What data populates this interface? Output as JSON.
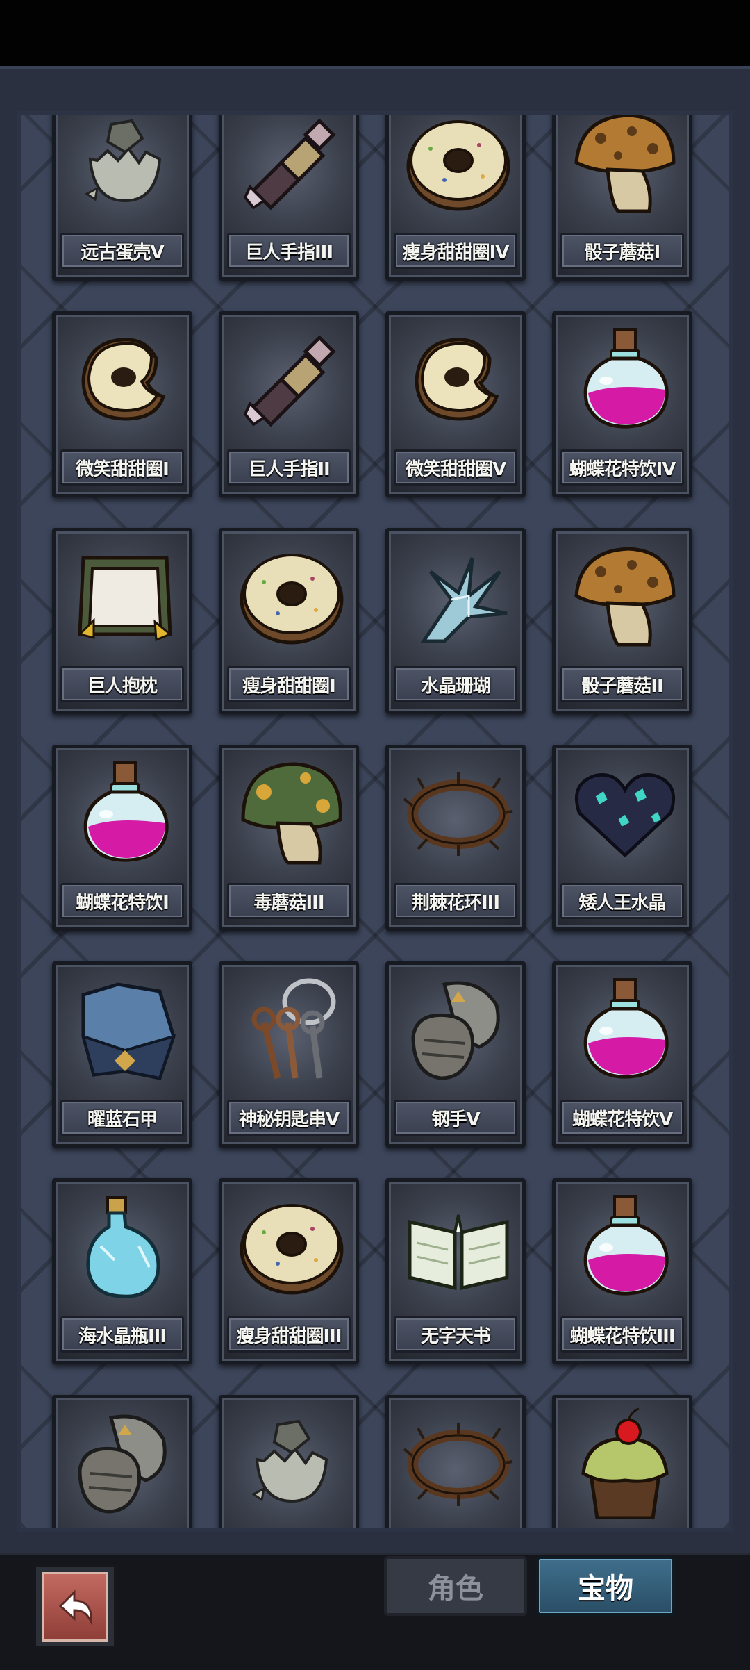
{
  "tabs": {
    "role": "角色",
    "treasure": "宝物"
  },
  "back_icon": "return-arrow-icon",
  "items": [
    {
      "label": "远古蛋壳V",
      "icon": "cracked-egg-shell-icon"
    },
    {
      "label": "巨人手指III",
      "icon": "giant-finger-icon"
    },
    {
      "label": "瘦身甜甜圈IV",
      "icon": "donut-icon"
    },
    {
      "label": "骰子蘑菇I",
      "icon": "mushroom-icon"
    },
    {
      "label": "微笑甜甜圈I",
      "icon": "bitten-donut-icon"
    },
    {
      "label": "巨人手指II",
      "icon": "giant-finger-icon"
    },
    {
      "label": "微笑甜甜圈V",
      "icon": "bitten-donut-icon"
    },
    {
      "label": "蝴蝶花特饮IV",
      "icon": "pink-potion-icon"
    },
    {
      "label": "巨人抱枕",
      "icon": "pillow-icon"
    },
    {
      "label": "瘦身甜甜圈I",
      "icon": "donut-icon"
    },
    {
      "label": "水晶珊瑚",
      "icon": "crystal-coral-icon"
    },
    {
      "label": "骰子蘑菇II",
      "icon": "mushroom-icon"
    },
    {
      "label": "蝴蝶花特饮I",
      "icon": "pink-potion-icon"
    },
    {
      "label": "毒蘑菇III",
      "icon": "poison-mushroom-icon"
    },
    {
      "label": "荆棘花环III",
      "icon": "thorn-wreath-icon"
    },
    {
      "label": "矮人王水晶",
      "icon": "dark-crystal-heart-icon"
    },
    {
      "label": "曜蓝石甲",
      "icon": "armor-icon"
    },
    {
      "label": "神秘钥匙串V",
      "icon": "key-ring-icon"
    },
    {
      "label": "钢手V",
      "icon": "steel-gauntlet-icon"
    },
    {
      "label": "蝴蝶花特饮V",
      "icon": "pink-potion-icon"
    },
    {
      "label": "海水晶瓶III",
      "icon": "blue-bottle-icon"
    },
    {
      "label": "瘦身甜甜圈III",
      "icon": "donut-icon"
    },
    {
      "label": "无字天书",
      "icon": "open-book-icon"
    },
    {
      "label": "蝴蝶花特饮III",
      "icon": "pink-potion-icon"
    },
    {
      "label": "",
      "icon": "steel-gauntlet-icon"
    },
    {
      "label": "",
      "icon": "cracked-egg-shell-icon"
    },
    {
      "label": "",
      "icon": "thorn-wreath-icon"
    },
    {
      "label": "",
      "icon": "cherry-cupcake-icon"
    }
  ]
}
